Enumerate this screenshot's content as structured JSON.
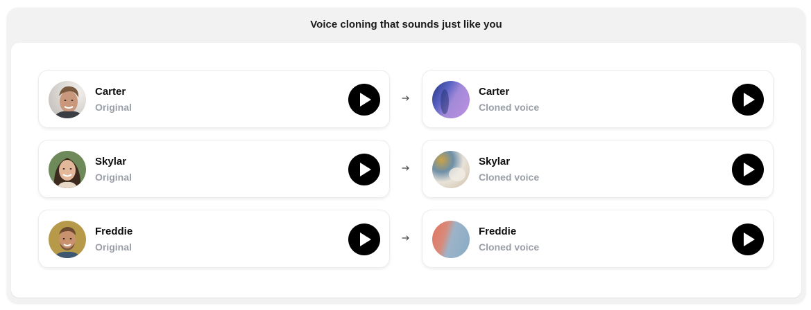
{
  "section": {
    "title": "Voice cloning that sounds just like you"
  },
  "rows": [
    {
      "original": {
        "name": "Carter",
        "label": "Original"
      },
      "cloned": {
        "name": "Carter",
        "label": "Cloned voice"
      }
    },
    {
      "original": {
        "name": "Skylar",
        "label": "Original"
      },
      "cloned": {
        "name": "Skylar",
        "label": "Cloned voice"
      }
    },
    {
      "original": {
        "name": "Freddie",
        "label": "Original"
      },
      "cloned": {
        "name": "Freddie",
        "label": "Cloned voice"
      }
    }
  ],
  "icons": {
    "play": "play-icon",
    "arrow": "arrow-right-icon"
  },
  "colors": {
    "play_button": "#000000",
    "subtitle": "#9a9ea6",
    "panel_bg": "#f2f2f2"
  }
}
